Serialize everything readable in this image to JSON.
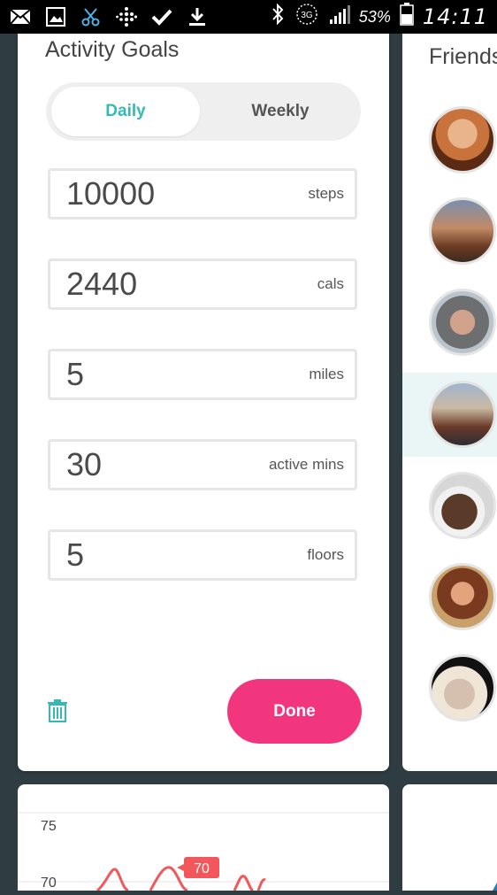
{
  "status_bar": {
    "battery_percent": "53%",
    "time": "14:11",
    "network": "3G",
    "icons": [
      "mail-icon",
      "image-icon",
      "scissors-icon",
      "fitbit-icon",
      "check-icon",
      "download-icon",
      "bluetooth-icon",
      "network-3g-icon",
      "signal-icon",
      "battery-icon"
    ]
  },
  "activity_goals": {
    "title": "Activity Goals",
    "tabs": {
      "daily": "Daily",
      "weekly": "Weekly",
      "selected": "Daily"
    },
    "goals": [
      {
        "value": "10000",
        "unit": "steps"
      },
      {
        "value": "2440",
        "unit": "cals"
      },
      {
        "value": "5",
        "unit": "miles"
      },
      {
        "value": "30",
        "unit": "active mins"
      },
      {
        "value": "5",
        "unit": "floors"
      }
    ],
    "done_label": "Done",
    "trash_icon": "trash-icon"
  },
  "friends": {
    "title": "Friends",
    "avatar_count": 7,
    "highlighted_index": 3
  },
  "chart_data": {
    "type": "line",
    "tick_labels": [
      "75",
      "70"
    ],
    "tooltip_value": "70",
    "series": [
      {
        "color": "#f2585b"
      }
    ]
  },
  "colors": {
    "accent_teal": "#35b9b6",
    "done_pink": "#f2367e",
    "background": "#2f3d42",
    "chart_line": "#f2585b"
  }
}
